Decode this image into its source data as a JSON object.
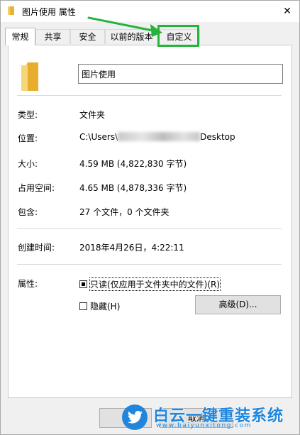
{
  "window": {
    "title": "图片使用 属性",
    "close_glyph": "✕"
  },
  "tabs": [
    {
      "label": "常规",
      "active": true
    },
    {
      "label": "共享",
      "active": false
    },
    {
      "label": "安全",
      "active": false
    },
    {
      "label": "以前的版本",
      "active": false
    },
    {
      "label": "自定义",
      "active": false
    }
  ],
  "general": {
    "folder_name": "图片使用",
    "rows": [
      {
        "label": "类型:",
        "value": "文件夹"
      },
      {
        "label": "位置:",
        "value_prefix": "C:\\Users\\",
        "value_suffix": "Desktop"
      },
      {
        "label": "大小:",
        "value": "4.59 MB (4,822,830 字节)"
      },
      {
        "label": "占用空间:",
        "value": "4.65 MB (4,878,336 字节)"
      },
      {
        "label": "包含:",
        "value": "27 个文件，0 个文件夹"
      }
    ],
    "created_label": "创建时间:",
    "created_value": "2018年4月26日，4:22:11",
    "attributes_label": "属性:",
    "readonly_label": "只读(仅应用于文件夹中的文件)(R)",
    "readonly_state": "indeterminate",
    "hidden_label": "隐藏(H)",
    "hidden_checked": false,
    "advanced_button": "高级(D)..."
  },
  "footer": {
    "ok_button": "",
    "cancel_button": "取消"
  },
  "annotation": {
    "highlight_color": "#24b43a"
  },
  "watermark": {
    "title": "白云一键重装系统",
    "url": "www.baiyunxitong.com",
    "color": "#1f86dc"
  }
}
